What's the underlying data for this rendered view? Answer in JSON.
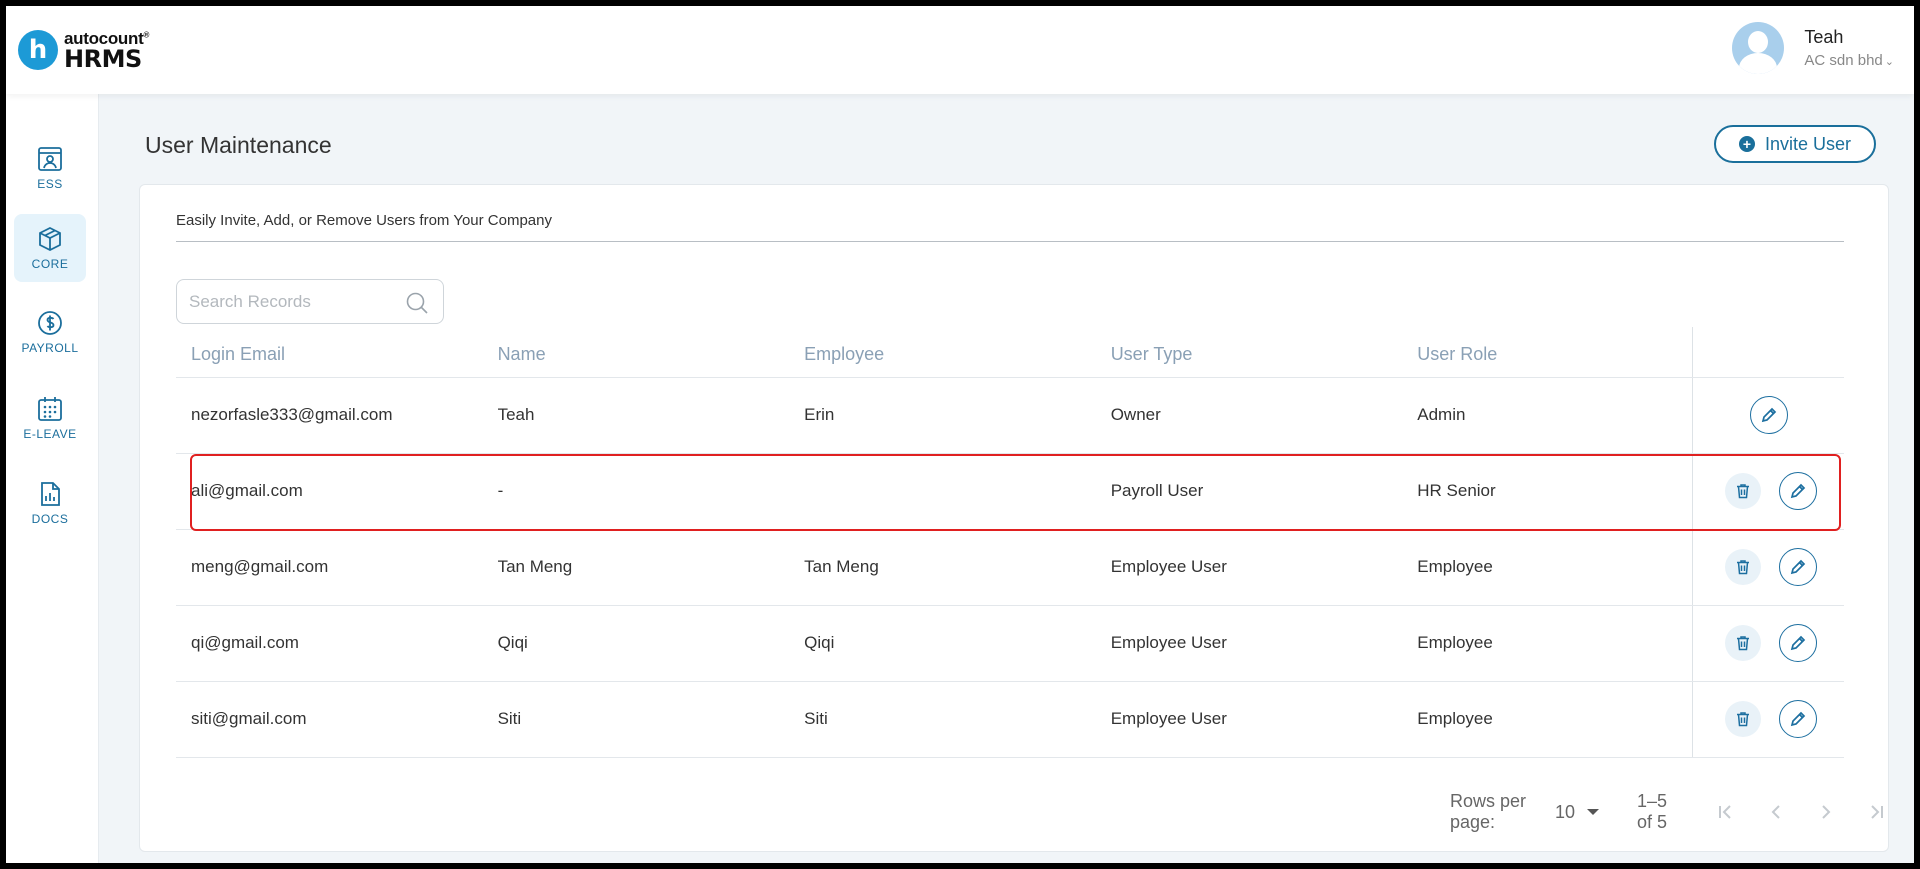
{
  "app": {
    "logo_top": "autocount",
    "logo_bottom": "HRMS",
    "logo_letter": "h"
  },
  "user": {
    "name": "Teah",
    "company": "AC sdn bhd"
  },
  "sidebar": {
    "items": [
      {
        "label": "ESS",
        "icon": "ess-icon",
        "active": false
      },
      {
        "label": "CORE",
        "icon": "cube-icon",
        "active": true
      },
      {
        "label": "PAYROLL",
        "icon": "dollar-icon",
        "active": false
      },
      {
        "label": "E-LEAVE",
        "icon": "calendar-icon",
        "active": false
      },
      {
        "label": "DOCS",
        "icon": "document-chart-icon",
        "active": false
      }
    ]
  },
  "page": {
    "title": "User Maintenance",
    "invite_label": "Invite User",
    "subtitle": "Easily Invite, Add, or Remove Users from Your Company",
    "search_placeholder": "Search Records"
  },
  "table": {
    "columns": [
      "Login Email",
      "Name",
      "Employee",
      "User Type",
      "User Role"
    ],
    "rows": [
      {
        "email": "nezorfasle333@gmail.com",
        "name": "Teah",
        "employee": "Erin",
        "type": "Owner",
        "role": "Admin",
        "deletable": false
      },
      {
        "email": "ali@gmail.com",
        "name": "-",
        "employee": "",
        "type": "Payroll User",
        "role": "HR Senior",
        "deletable": true
      },
      {
        "email": "meng@gmail.com",
        "name": "Tan Meng",
        "employee": "Tan Meng",
        "type": "Employee User",
        "role": "Employee",
        "deletable": true
      },
      {
        "email": "qi@gmail.com",
        "name": "Qiqi",
        "employee": "Qiqi",
        "type": "Employee User",
        "role": "Employee",
        "deletable": true
      },
      {
        "email": "siti@gmail.com",
        "name": "Siti",
        "employee": "Siti",
        "type": "Employee User",
        "role": "Employee",
        "deletable": true
      }
    ]
  },
  "pagination": {
    "rows_label": "Rows per page:",
    "rows_value": "10",
    "range": "1–5 of 5"
  },
  "colors": {
    "accent": "#1a6f9b",
    "highlight": "#e02020",
    "header_text": "#8aa0b5"
  }
}
